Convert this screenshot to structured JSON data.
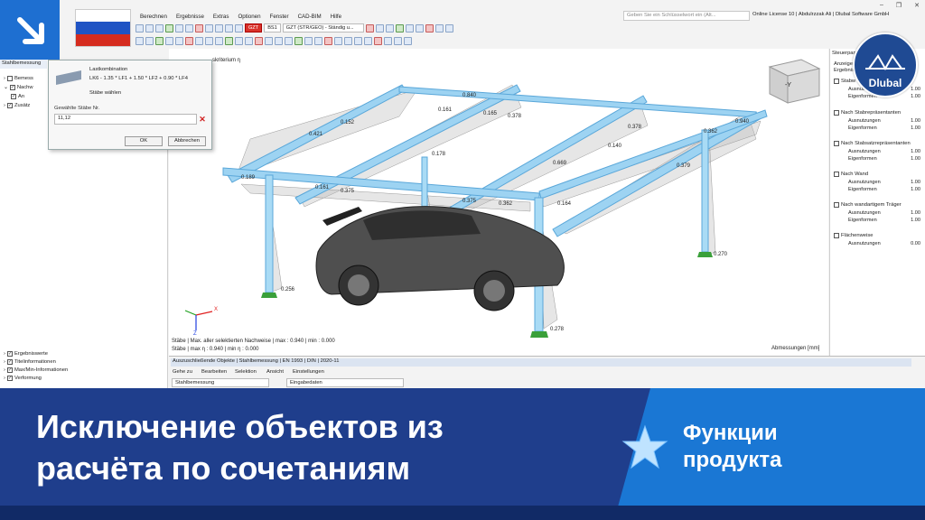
{
  "app": {
    "menu": [
      "Berechnen",
      "Ergebnisse",
      "Extras",
      "Optionen",
      "Fenster",
      "CAD-BIM",
      "Hilfe"
    ],
    "search_placeholder": "Geben Sie ein Schlüsselwort ein (Alt...",
    "license": "Online License 10 | Abdulrzzak Ali | Dlubal Software GmbH",
    "toolbar_lc_badge": "GZT",
    "toolbar_lc_code": "BS1",
    "toolbar_lc_name": "GZT (STR/GEO) - Ständig u..."
  },
  "navigator": {
    "header": "Stahlbemessung",
    "items": [
      "Bemess",
      "Nachw",
      "An",
      "Zusätz"
    ],
    "bottom_items": [
      "Ergebniswerte",
      "Titelinformationen",
      "Max/Min-Informationen",
      "Verformung"
    ]
  },
  "dialog": {
    "combo_label": "Lastkombination",
    "combo_value": "LK6 - 1.35 * LF1 + 1.50 * LF2 + 0.90 * LF4",
    "select_members": "Stäbe wählen",
    "members_label": "Gewählte Stäbe Nr.",
    "members_value": "11,12",
    "ok": "OK",
    "cancel": "Abbrechen"
  },
  "viewport": {
    "criterion": "skriterium η",
    "values": [
      "0.840",
      "0.161",
      "0.165",
      "0.378",
      "0.152",
      "0.421",
      "0.178",
      "0.140",
      "0.378",
      "0.940",
      "0.362",
      "0.379",
      "0.669",
      "0.189",
      "0.161",
      "0.375",
      "0.375",
      "0.362",
      "0.164",
      "0.256",
      "0.278",
      "0.270"
    ],
    "status1": "Stäbe | Max. aller selektierten Nachweise | max : 0.940 | min : 0.000",
    "status2": "Stäbe | max η : 0.940 | min η : 0.000",
    "dims": "Abmessungen [mm]",
    "axis_x": "X",
    "axis_z": "Z",
    "cube_face": "-Y"
  },
  "ctrlpanel": {
    "title": "Steuerpan",
    "sub1": "Anzeige",
    "sub2": "Ergebnis",
    "groups": [
      {
        "name": "Stabw",
        "rows": [
          [
            "Ausnutzungen",
            "1.00"
          ],
          [
            "Eigenformen",
            "1.00"
          ]
        ]
      },
      {
        "name": "Nach Stabrepräsentanten",
        "rows": [
          [
            "Ausnutzungen",
            "1.00"
          ],
          [
            "Eigenformen",
            "1.00"
          ]
        ]
      },
      {
        "name": "Nach Stabsatzrepräsentanten",
        "rows": [
          [
            "Ausnutzungen",
            "1.00"
          ],
          [
            "Eigenformen",
            "1.00"
          ]
        ]
      },
      {
        "name": "Nach Wand",
        "rows": [
          [
            "Ausnutzungen",
            "1.00"
          ],
          [
            "Eigenformen",
            "1.00"
          ]
        ]
      },
      {
        "name": "Nach wandartigem Träger",
        "rows": [
          [
            "Ausnutzungen",
            "1.00"
          ],
          [
            "Eigenformen",
            "1.00"
          ]
        ]
      },
      {
        "name": "Flächenweise",
        "rows": [
          [
            "Ausnutzungen",
            "0.00"
          ]
        ]
      }
    ]
  },
  "logo_text": "Dlubal",
  "bottom_panel": {
    "title": "Auszuschließende Objekte | Stahlbemessung | EN 1993 | DIN | 2020-11",
    "menu": [
      "Gehe zu",
      "Bearbeiten",
      "Selektion",
      "Ansicht",
      "Einstellungen"
    ],
    "select1": "Stahlbemessung",
    "select2": "Eingabedaten"
  },
  "banner": {
    "title_line1": "Исключение объектов из",
    "title_line2": "расчёта по сочетаниям",
    "subtitle1": "Функции",
    "subtitle2": "продукта"
  },
  "colors": {
    "banner_bg": "#1f3e8c",
    "banner_accent": "#1a77d4",
    "member_blue": "#8cc8ee",
    "support_green": "#3aa03a"
  }
}
